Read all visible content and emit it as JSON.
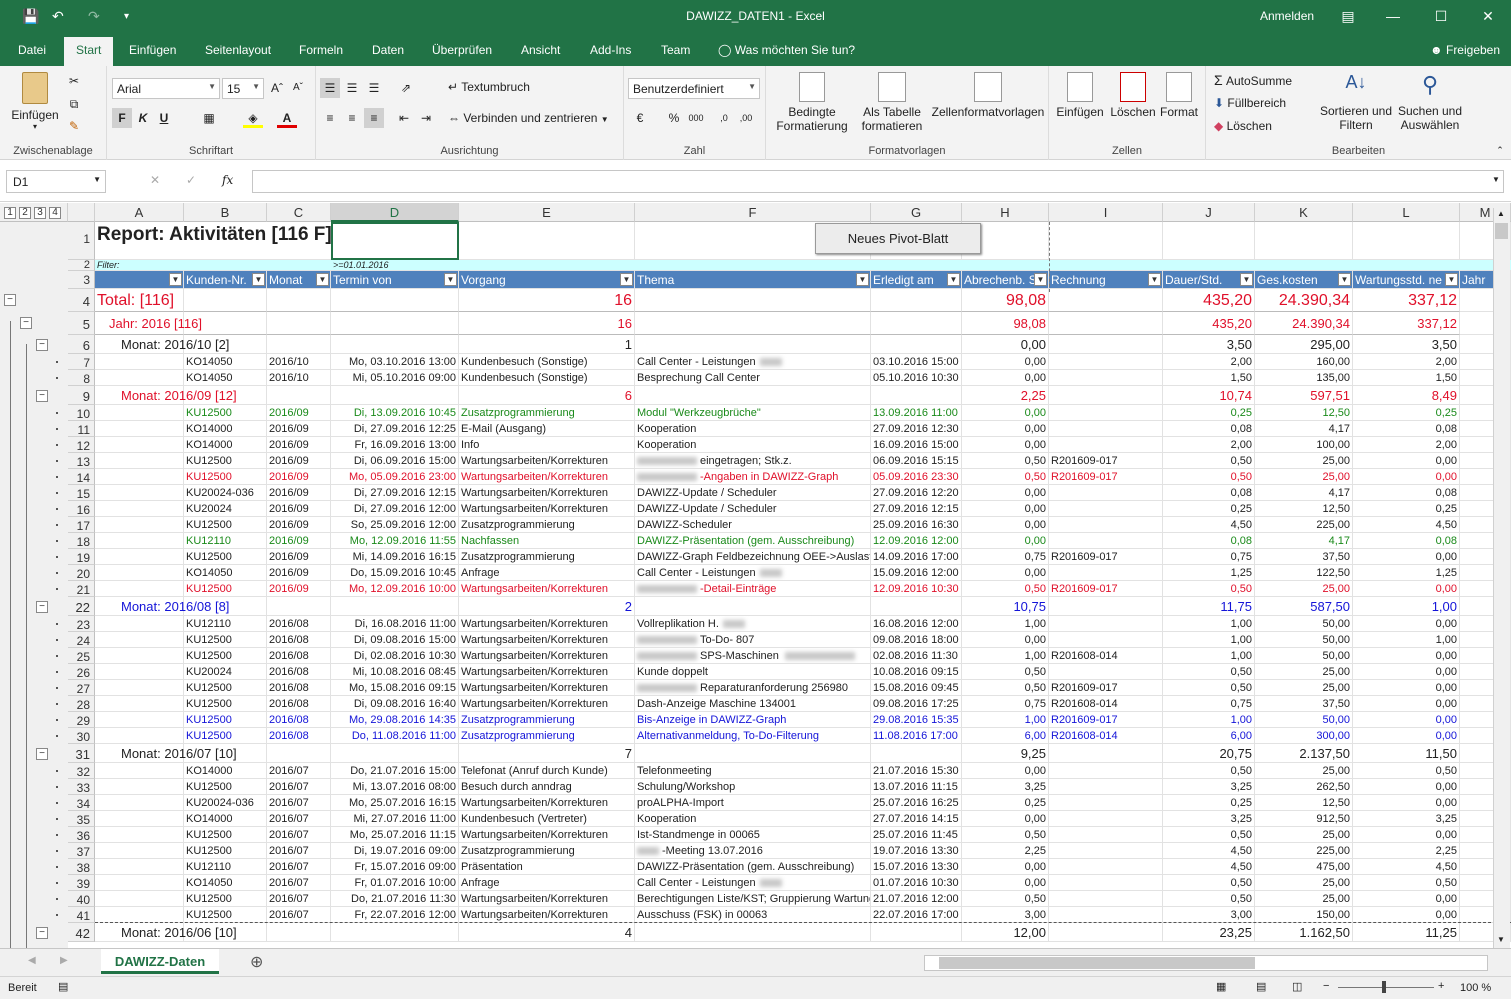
{
  "app": {
    "title": "DAWIZZ_DATEN1 - Excel",
    "anmelden": "Anmelden",
    "freigeben": "Freigeben"
  },
  "menu": {
    "tabs": [
      "Datei",
      "Start",
      "Einfügen",
      "Seitenlayout",
      "Formeln",
      "Daten",
      "Überprüfen",
      "Ansicht",
      "Add-Ins",
      "Team"
    ],
    "active": "Start",
    "tell_me": "Was möchten Sie tun?"
  },
  "ribbon": {
    "clipboard": {
      "paste": "Einfügen",
      "label": "Zwischenablage"
    },
    "font": {
      "name": "Arial",
      "size": "15",
      "bold": "F",
      "italic": "K",
      "underline": "U",
      "label": "Schriftart"
    },
    "alignment": {
      "wrap": "Textumbruch",
      "merge": "Verbinden und zentrieren",
      "label": "Ausrichtung"
    },
    "number": {
      "format": "Benutzerdefiniert",
      "label": "Zahl"
    },
    "styles": {
      "cond": "Bedingte",
      "cond2": "Formatierung",
      "table": "Als Tabelle",
      "table2": "formatieren",
      "cellstyles": "Zellenformatvorlagen",
      "label": "Formatvorlagen"
    },
    "cells": {
      "insert": "Einfügen",
      "delete": "Löschen",
      "format": "Format",
      "label": "Zellen"
    },
    "editing": {
      "autosum": "AutoSumme",
      "fill": "Füllbereich",
      "clear": "Löschen",
      "sort": "Sortieren und",
      "sort2": "Filtern",
      "find": "Suchen und",
      "find2": "Auswählen",
      "label": "Bearbeiten"
    }
  },
  "formula": {
    "namebox": "D1",
    "fx": "fx"
  },
  "sheet": {
    "outline_levels": [
      "1",
      "2",
      "3",
      "4"
    ],
    "columns": [
      "A",
      "B",
      "C",
      "D",
      "E",
      "F",
      "G",
      "H",
      "I",
      "J",
      "K",
      "L",
      "M"
    ],
    "title": "Report: Aktivitäten [116 F]",
    "button": "Neues Pivot-Blatt",
    "filter_label": "Filter:",
    "filter_value": ">=01.01.2016",
    "headers": [
      "Kunden-Nr.",
      "Monat",
      "Termin von",
      "Vorgang",
      "Thema",
      "Erledigt am",
      "Abrechenb. S",
      "Rechnung",
      "Dauer/Std.",
      "Ges.kosten",
      "Wartungsstd. ne",
      "Jahr"
    ],
    "rows": [
      {
        "n": "4",
        "t": "total",
        "a": "Total:  [116]",
        "e": "16",
        "h": "98,08",
        "j": "435,20",
        "k": "24.390,34",
        "l": "337,12"
      },
      {
        "n": "5",
        "t": "year",
        "a": "Jahr: 2016 [116]",
        "e": "16",
        "h": "98,08",
        "j": "435,20",
        "k": "24.390,34",
        "l": "337,12"
      },
      {
        "n": "6",
        "t": "month",
        "c": "black",
        "a": "Monat: 2016/10 [2]",
        "e": "1",
        "h": "0,00",
        "j": "3,50",
        "k": "295,00",
        "l": "3,50"
      },
      {
        "n": "7",
        "c": "black",
        "b": "KO14050",
        "m": "2016/10",
        "d": "Mo, 03.10.2016 13:00",
        "e": "Kundenbesuch (Sonstige)",
        "f": "Call Center - Leistungen",
        "g": "03.10.2016 15:00",
        "h": "0,00",
        "j": "2,00",
        "k": "160,00",
        "l": "2,00"
      },
      {
        "n": "8",
        "c": "black",
        "b": "KO14050",
        "m": "2016/10",
        "d": "Mi, 05.10.2016 09:00",
        "e": "Kundenbesuch (Sonstige)",
        "f": "Besprechung Call Center",
        "g": "05.10.2016 10:30",
        "h": "0,00",
        "j": "1,50",
        "k": "135,00",
        "l": "1,50"
      },
      {
        "n": "9",
        "t": "month",
        "c": "red",
        "a": "Monat: 2016/09 [12]",
        "e": "6",
        "h": "2,25",
        "j": "10,74",
        "k": "597,51",
        "l": "8,49"
      },
      {
        "n": "10",
        "c": "green",
        "b": "KU12500",
        "m": "2016/09",
        "d": "Di, 13.09.2016 10:45",
        "e": "Zusatzprogrammierung",
        "f": "Modul \"Werkzeugbrüche\"",
        "g": "13.09.2016 11:00",
        "h": "0,00",
        "j": "0,25",
        "k": "12,50",
        "l": "0,25"
      },
      {
        "n": "11",
        "c": "black",
        "b": "KO14000",
        "m": "2016/09",
        "d": "Di, 27.09.2016 12:25",
        "e": "E-Mail (Ausgang)",
        "f": "Kooperation",
        "g": "27.09.2016 12:30",
        "h": "0,00",
        "j": "0,08",
        "k": "4,17",
        "l": "0,08"
      },
      {
        "n": "12",
        "c": "black",
        "b": "KO14000",
        "m": "2016/09",
        "d": "Fr, 16.09.2016 13:00",
        "e": "Info",
        "f": "Kooperation",
        "g": "16.09.2016 15:00",
        "h": "0,00",
        "j": "2,00",
        "k": "100,00",
        "l": "2,00"
      },
      {
        "n": "13",
        "c": "black",
        "b": "KU12500",
        "m": "2016/09",
        "d": "Di, 06.09.2016 15:00",
        "e": "Wartungsarbeiten/Korrekturen",
        "f": "eingetragen; Stk.z.",
        "g": "06.09.2016 15:15",
        "h": "0,50",
        "i": "R201609-017",
        "j": "0,50",
        "k": "25,00",
        "l": "0,00"
      },
      {
        "n": "14",
        "c": "red",
        "b": "KU12500",
        "m": "2016/09",
        "d": "Mo, 05.09.2016 23:00",
        "e": "Wartungsarbeiten/Korrekturen",
        "f": "-Angaben in DAWIZZ-Graph",
        "g": "05.09.2016 23:30",
        "h": "0,50",
        "i": "R201609-017",
        "j": "0,50",
        "k": "25,00",
        "l": "0,00"
      },
      {
        "n": "15",
        "c": "black",
        "b": "KU20024-036",
        "m": "2016/09",
        "d": "Di, 27.09.2016 12:15",
        "e": "Wartungsarbeiten/Korrekturen",
        "f": "DAWIZZ-Update / Scheduler",
        "g": "27.09.2016 12:20",
        "h": "0,00",
        "j": "0,08",
        "k": "4,17",
        "l": "0,08"
      },
      {
        "n": "16",
        "c": "black",
        "b": "KU20024",
        "m": "2016/09",
        "d": "Di, 27.09.2016 12:00",
        "e": "Wartungsarbeiten/Korrekturen",
        "f": "DAWIZZ-Update / Scheduler",
        "g": "27.09.2016 12:15",
        "h": "0,00",
        "j": "0,25",
        "k": "12,50",
        "l": "0,25"
      },
      {
        "n": "17",
        "c": "black",
        "b": "KU12500",
        "m": "2016/09",
        "d": "So, 25.09.2016 12:00",
        "e": "Zusatzprogrammierung",
        "f": "DAWIZZ-Scheduler",
        "g": "25.09.2016 16:30",
        "h": "0,00",
        "j": "4,50",
        "k": "225,00",
        "l": "4,50"
      },
      {
        "n": "18",
        "c": "green",
        "b": "KU12110",
        "m": "2016/09",
        "d": "Mo, 12.09.2016 11:55",
        "e": "Nachfassen",
        "f": "DAWIZZ-Präsentation (gem. Ausschreibung)",
        "g": "12.09.2016 12:00",
        "h": "0,00",
        "j": "0,08",
        "k": "4,17",
        "l": "0,08"
      },
      {
        "n": "19",
        "c": "black",
        "b": "KU12500",
        "m": "2016/09",
        "d": "Mi, 14.09.2016 16:15",
        "e": "Zusatzprogrammierung",
        "f": "DAWIZZ-Graph Feldbezeichnung OEE->Auslast",
        "g": "14.09.2016 17:00",
        "h": "0,75",
        "i": "R201609-017",
        "j": "0,75",
        "k": "37,50",
        "l": "0,00"
      },
      {
        "n": "20",
        "c": "black",
        "b": "KO14050",
        "m": "2016/09",
        "d": "Do, 15.09.2016 10:45",
        "e": "Anfrage",
        "f": "Call Center - Leistungen",
        "g": "15.09.2016 12:00",
        "h": "0,00",
        "j": "1,25",
        "k": "122,50",
        "l": "1,25"
      },
      {
        "n": "21",
        "c": "red",
        "b": "KU12500",
        "m": "2016/09",
        "d": "Mo, 12.09.2016 10:00",
        "e": "Wartungsarbeiten/Korrekturen",
        "f": "-Detail-Einträge",
        "g": "12.09.2016 10:30",
        "h": "0,50",
        "i": "R201609-017",
        "j": "0,50",
        "k": "25,00",
        "l": "0,00"
      },
      {
        "n": "22",
        "t": "month",
        "c": "blue",
        "a": "Monat: 2016/08 [8]",
        "e": "2",
        "h": "10,75",
        "j": "11,75",
        "k": "587,50",
        "l": "1,00"
      },
      {
        "n": "23",
        "c": "black",
        "b": "KU12110",
        "m": "2016/08",
        "d": "Di, 16.08.2016 11:00",
        "e": "Wartungsarbeiten/Korrekturen",
        "f": "Vollreplikation H.",
        "g": "16.08.2016 12:00",
        "h": "1,00",
        "j": "1,00",
        "k": "50,00",
        "l": "0,00"
      },
      {
        "n": "24",
        "c": "black",
        "b": "KU12500",
        "m": "2016/08",
        "d": "Di, 09.08.2016 15:00",
        "e": "Wartungsarbeiten/Korrekturen",
        "f": "To-Do- 807",
        "g": "09.08.2016 18:00",
        "h": "0,00",
        "j": "1,00",
        "k": "50,00",
        "l": "1,00"
      },
      {
        "n": "25",
        "c": "black",
        "b": "KU12500",
        "m": "2016/08",
        "d": "Di, 02.08.2016 10:30",
        "e": "Wartungsarbeiten/Korrekturen",
        "f": "SPS-Maschinen",
        "g": "02.08.2016 11:30",
        "h": "1,00",
        "i": "R201608-014",
        "j": "1,00",
        "k": "50,00",
        "l": "0,00"
      },
      {
        "n": "26",
        "c": "black",
        "b": "KU20024",
        "m": "2016/08",
        "d": "Mi, 10.08.2016 08:45",
        "e": "Wartungsarbeiten/Korrekturen",
        "f": "Kunde doppelt",
        "g": "10.08.2016 09:15",
        "h": "0,50",
        "j": "0,50",
        "k": "25,00",
        "l": "0,00"
      },
      {
        "n": "27",
        "c": "black",
        "b": "KU12500",
        "m": "2016/08",
        "d": "Mo, 15.08.2016 09:15",
        "e": "Wartungsarbeiten/Korrekturen",
        "f": "Reparaturanforderung 256980",
        "g": "15.08.2016 09:45",
        "h": "0,50",
        "i": "R201609-017",
        "j": "0,50",
        "k": "25,00",
        "l": "0,00"
      },
      {
        "n": "28",
        "c": "black",
        "b": "KU12500",
        "m": "2016/08",
        "d": "Di, 09.08.2016 16:40",
        "e": "Wartungsarbeiten/Korrekturen",
        "f": "Dash-Anzeige Maschine 134001",
        "g": "09.08.2016 17:25",
        "h": "0,75",
        "i": "R201608-014",
        "j": "0,75",
        "k": "37,50",
        "l": "0,00"
      },
      {
        "n": "29",
        "c": "blue",
        "b": "KU12500",
        "m": "2016/08",
        "d": "Mo, 29.08.2016 14:35",
        "e": "Zusatzprogrammierung",
        "f": "Bis-Anzeige in DAWIZZ-Graph",
        "g": "29.08.2016 15:35",
        "h": "1,00",
        "i": "R201609-017",
        "j": "1,00",
        "k": "50,00",
        "l": "0,00"
      },
      {
        "n": "30",
        "c": "blue",
        "b": "KU12500",
        "m": "2016/08",
        "d": "Do, 11.08.2016 11:00",
        "e": "Zusatzprogrammierung",
        "f": "Alternativanmeldung, To-Do-Filterung",
        "g": "11.08.2016 17:00",
        "h": "6,00",
        "i": "R201608-014",
        "j": "6,00",
        "k": "300,00",
        "l": "0,00"
      },
      {
        "n": "31",
        "t": "month",
        "c": "black",
        "a": "Monat: 2016/07 [10]",
        "e": "7",
        "h": "9,25",
        "j": "20,75",
        "k": "2.137,50",
        "l": "11,50"
      },
      {
        "n": "32",
        "c": "black",
        "b": "KO14000",
        "m": "2016/07",
        "d": "Do, 21.07.2016 15:00",
        "e": "Telefonat (Anruf durch Kunde)",
        "f": "Telefonmeeting",
        "g": "21.07.2016 15:30",
        "h": "0,00",
        "j": "0,50",
        "k": "25,00",
        "l": "0,50"
      },
      {
        "n": "33",
        "c": "black",
        "b": "KU12500",
        "m": "2016/07",
        "d": "Mi, 13.07.2016 08:00",
        "e": "Besuch durch anndrag",
        "f": "Schulung/Workshop",
        "g": "13.07.2016 11:15",
        "h": "3,25",
        "j": "3,25",
        "k": "262,50",
        "l": "0,00"
      },
      {
        "n": "34",
        "c": "black",
        "b": "KU20024-036",
        "m": "2016/07",
        "d": "Mo, 25.07.2016 16:15",
        "e": "Wartungsarbeiten/Korrekturen",
        "f": "proALPHA-Import",
        "g": "25.07.2016 16:25",
        "h": "0,25",
        "j": "0,25",
        "k": "12,50",
        "l": "0,00"
      },
      {
        "n": "35",
        "c": "black",
        "b": "KO14000",
        "m": "2016/07",
        "d": "Mi, 27.07.2016 11:00",
        "e": "Kundenbesuch (Vertreter)",
        "f": "Kooperation",
        "g": "27.07.2016 14:15",
        "h": "0,00",
        "j": "3,25",
        "k": "912,50",
        "l": "3,25"
      },
      {
        "n": "36",
        "c": "black",
        "b": "KU12500",
        "m": "2016/07",
        "d": "Mo, 25.07.2016 11:15",
        "e": "Wartungsarbeiten/Korrekturen",
        "f": "Ist-Standmenge in 00065",
        "g": "25.07.2016 11:45",
        "h": "0,50",
        "j": "0,50",
        "k": "25,00",
        "l": "0,00"
      },
      {
        "n": "37",
        "c": "black",
        "b": "KU12500",
        "m": "2016/07",
        "d": "Di, 19.07.2016 09:00",
        "e": "Zusatzprogrammierung",
        "f": "-Meeting 13.07.2016",
        "g": "19.07.2016 13:30",
        "h": "2,25",
        "j": "4,50",
        "k": "225,00",
        "l": "2,25"
      },
      {
        "n": "38",
        "c": "black",
        "b": "KU12110",
        "m": "2016/07",
        "d": "Fr, 15.07.2016 09:00",
        "e": "Präsentation",
        "f": "DAWIZZ-Präsentation (gem. Ausschreibung)",
        "g": "15.07.2016 13:30",
        "h": "0,00",
        "j": "4,50",
        "k": "475,00",
        "l": "4,50"
      },
      {
        "n": "39",
        "c": "black",
        "b": "KO14050",
        "m": "2016/07",
        "d": "Fr, 01.07.2016 10:00",
        "e": "Anfrage",
        "f": "Call Center - Leistungen",
        "g": "01.07.2016 10:30",
        "h": "0,00",
        "j": "0,50",
        "k": "25,00",
        "l": "0,50"
      },
      {
        "n": "40",
        "c": "black",
        "b": "KU12500",
        "m": "2016/07",
        "d": "Do, 21.07.2016 11:30",
        "e": "Wartungsarbeiten/Korrekturen",
        "f": "Berechtigungen Liste/KST; Gruppierung Wartung",
        "g": "21.07.2016 12:00",
        "h": "0,50",
        "j": "0,50",
        "k": "25,00",
        "l": "0,00"
      },
      {
        "n": "41",
        "c": "black",
        "b": "KU12500",
        "m": "2016/07",
        "d": "Fr, 22.07.2016 12:00",
        "e": "Wartungsarbeiten/Korrekturen",
        "f": "Ausschuss (FSK) in 00063",
        "g": "22.07.2016 17:00",
        "h": "3,00",
        "j": "3,00",
        "k": "150,00",
        "l": "0,00"
      },
      {
        "n": "42",
        "t": "month",
        "c": "black",
        "a": "Monat: 2016/06 [10]",
        "e": "4",
        "h": "12,00",
        "j": "23,25",
        "k": "1.162,50",
        "l": "11,25"
      }
    ],
    "tab": "DAWIZZ-Daten"
  },
  "status": {
    "ready": "Bereit",
    "zoom": "100 %"
  }
}
